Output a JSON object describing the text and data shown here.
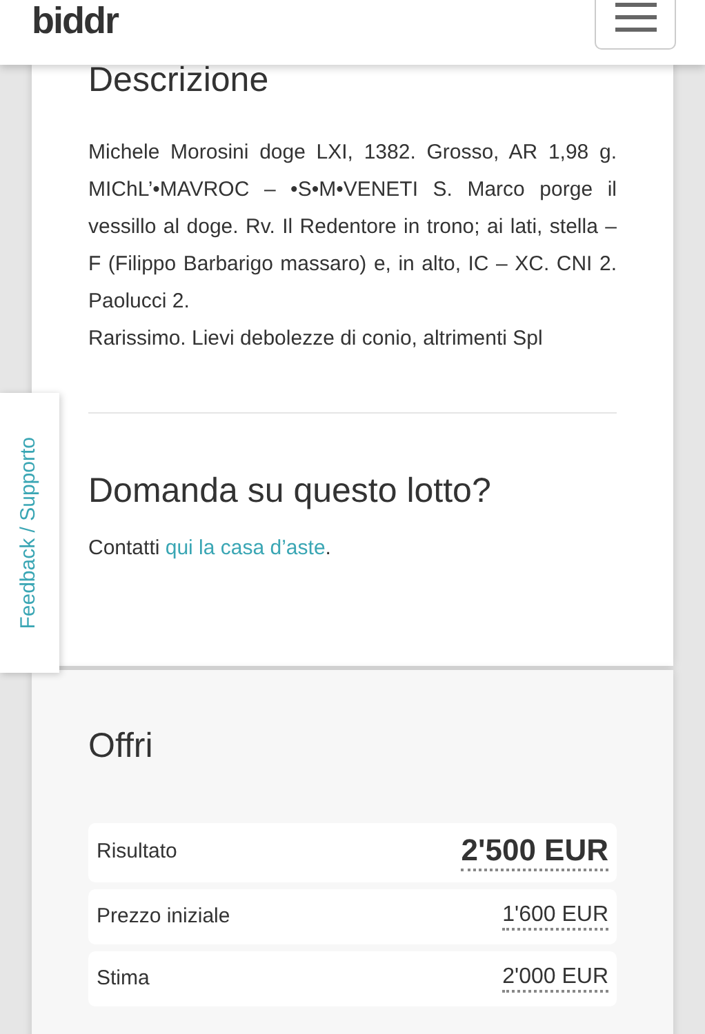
{
  "navbar": {
    "logo": "biddr"
  },
  "description": {
    "title": "Descrizione",
    "paragraphs": [
      "Michele Morosini doge LXI, 1382. Grosso, AR 1,98 g. MIChL’•MAVROC – •S•M•VENETI S. Marco porge il vessillo al doge. Rv. Il Redentore in trono; ai lati, stella – F (Filippo Barbarigo massaro) e, in alto, IC – XC. CNI 2. Paolucci 2.",
      "Rarissimo. Lievi debolezze di conio, altrimenti Spl"
    ]
  },
  "question": {
    "title": "Domanda su questo lotto?",
    "text_before": "Contatti",
    "link": "qui la casa d’aste",
    "text_after": "."
  },
  "feedback_tab": "Feedback / Supporto",
  "offer": {
    "title": "Offri",
    "rows": [
      {
        "label": "Risultato",
        "value": "2'500 EUR",
        "kind": "result"
      },
      {
        "label": "Prezzo iniziale",
        "value": "1'600 EUR",
        "kind": "price"
      },
      {
        "label": "Stima",
        "value": "2'000 EUR",
        "kind": "price"
      }
    ]
  }
}
